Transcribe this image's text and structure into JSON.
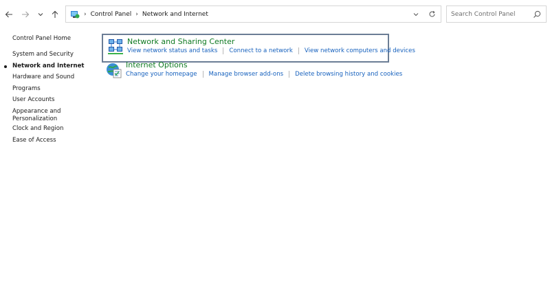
{
  "window": {
    "breadcrumb": [
      "Control Panel",
      "Network and Internet"
    ]
  },
  "search": {
    "placeholder": "Search Control Panel"
  },
  "sidebar": {
    "items": [
      {
        "label": "Control Panel Home",
        "active": false
      },
      {
        "label": "System and Security",
        "active": false
      },
      {
        "label": "Network and Internet",
        "active": true
      },
      {
        "label": "Hardware and Sound",
        "active": false
      },
      {
        "label": "Programs",
        "active": false
      },
      {
        "label": "User Accounts",
        "active": false
      },
      {
        "label": "Appearance and",
        "active": false
      },
      {
        "label": "Personalization",
        "active": false
      },
      {
        "label": "Clock and Region",
        "active": false
      },
      {
        "label": "Ease of Access",
        "active": false
      }
    ]
  },
  "categories": [
    {
      "title": "Network and Sharing Center",
      "icon": "network-sharing-icon",
      "links": [
        "View network status and tasks",
        "Connect to a network",
        "View network computers and devices"
      ]
    },
    {
      "title": "Internet Options",
      "icon": "internet-options-icon",
      "links": [
        "Change your homepage",
        "Manage browser add-ons",
        "Delete browsing history and cookies"
      ]
    }
  ],
  "colors": {
    "link": "#1560bd",
    "title": "#0f7a22",
    "focus_border": "#6b7d95"
  }
}
